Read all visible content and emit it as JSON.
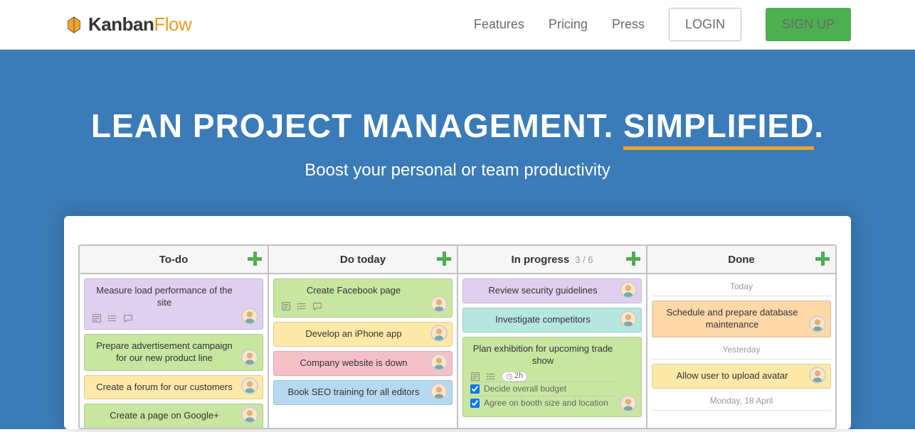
{
  "brand": {
    "name_a": "Kanban",
    "name_b": "Flow"
  },
  "nav": {
    "features": "Features",
    "pricing": "Pricing",
    "press": "Press",
    "login": "LOGIN",
    "signup": "SIGN UP"
  },
  "hero": {
    "line_a": "LEAN PROJECT MANAGEMENT.",
    "line_b": "SIMPLIFIED",
    "dot": ".",
    "sub": "Boost your personal or team productivity"
  },
  "board": {
    "columns": [
      {
        "title": "To-do",
        "count": "",
        "cards": [
          {
            "text": "Measure load performance of the site",
            "color": "purple",
            "meta": true
          },
          {
            "text": "Prepare advertisement campaign for our new product line",
            "color": "green"
          },
          {
            "text": "Create a forum for our customers",
            "color": "yellow"
          },
          {
            "text": "Create a page on Google+",
            "color": "green"
          }
        ]
      },
      {
        "title": "Do today",
        "count": "",
        "cards": [
          {
            "text": "Create Facebook page",
            "color": "green",
            "meta": true
          },
          {
            "text": "Develop an iPhone app",
            "color": "yellow"
          },
          {
            "text": "Company website is down",
            "color": "pink"
          },
          {
            "text": "Book SEO training for all editors",
            "color": "blue"
          }
        ]
      },
      {
        "title": "In progress",
        "count": "3 / 6",
        "cards": [
          {
            "text": "Review security guidelines",
            "color": "purple"
          },
          {
            "text": "Investigate competitors",
            "color": "teal"
          },
          {
            "text": "Plan exhibition for upcoming trade show",
            "color": "green",
            "time": "2h",
            "subs": [
              "Decide overall budget",
              "Agree on booth size and location"
            ]
          }
        ]
      },
      {
        "title": "Done",
        "count": "",
        "groups": [
          {
            "label": "Today",
            "cards": [
              {
                "text": "Schedule and prepare database maintenance",
                "color": "orange"
              }
            ]
          },
          {
            "label": "Yesterday",
            "cards": [
              {
                "text": "Allow user to upload avatar",
                "color": "yellow"
              }
            ]
          },
          {
            "label": "Monday, 18 April",
            "cards": []
          }
        ]
      }
    ]
  }
}
